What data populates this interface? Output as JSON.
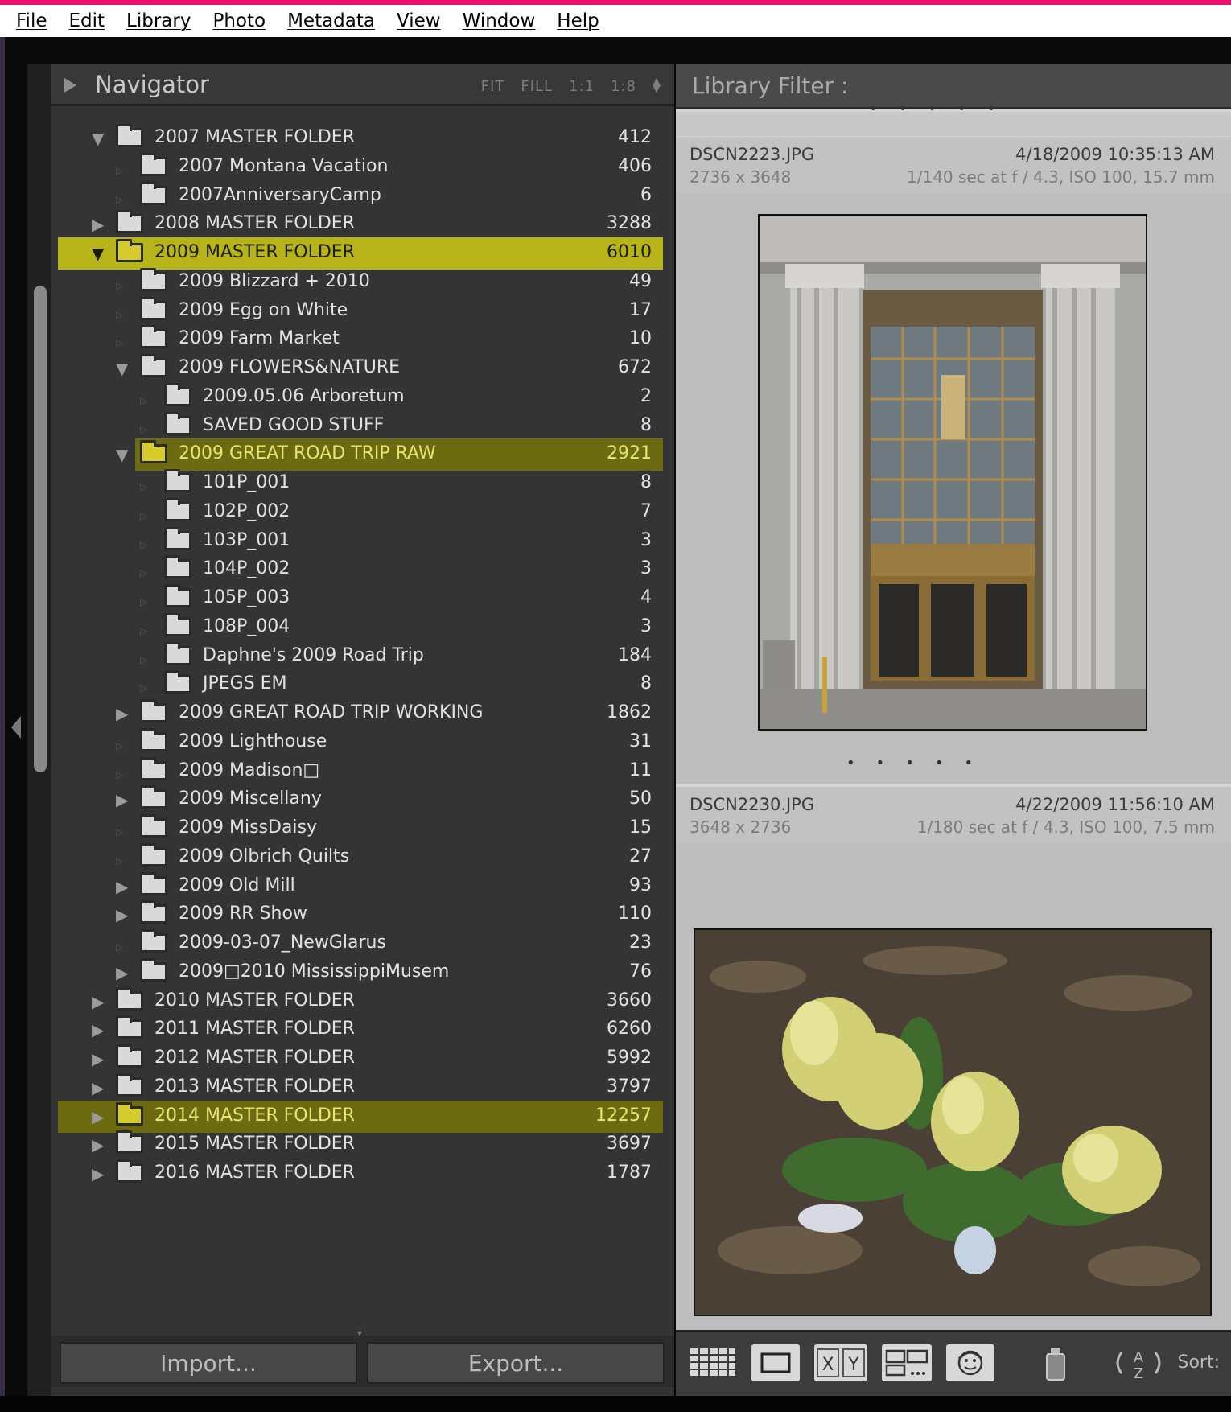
{
  "menu": [
    "File",
    "Edit",
    "Library",
    "Photo",
    "Metadata",
    "View",
    "Window",
    "Help"
  ],
  "navigator": {
    "title": "Navigator",
    "zoom_options": [
      "FIT",
      "FILL",
      "1:1",
      "1:8"
    ]
  },
  "folders": [
    {
      "name": "2007 MASTER FOLDER",
      "count": "412",
      "level": 0,
      "disclosure": "expanded",
      "highlight": "none"
    },
    {
      "name": "2007 Montana Vacation",
      "count": "406",
      "level": 1,
      "disclosure": "none",
      "highlight": "none"
    },
    {
      "name": "2007AnniversaryCamp",
      "count": "6",
      "level": 1,
      "disclosure": "none",
      "highlight": "none"
    },
    {
      "name": "2008 MASTER FOLDER",
      "count": "3288",
      "level": 0,
      "disclosure": "collapsed",
      "highlight": "none"
    },
    {
      "name": "2009 MASTER FOLDER",
      "count": "6010",
      "level": 0,
      "disclosure": "expanded",
      "highlight": "selected"
    },
    {
      "name": "2009 Blizzard + 2010",
      "count": "49",
      "level": 1,
      "disclosure": "none",
      "highlight": "none"
    },
    {
      "name": "2009 Egg on White",
      "count": "17",
      "level": 1,
      "disclosure": "none",
      "highlight": "none"
    },
    {
      "name": "2009 Farm Market",
      "count": "10",
      "level": 1,
      "disclosure": "none",
      "highlight": "none"
    },
    {
      "name": "2009 FLOWERS&NATURE",
      "count": "672",
      "level": 1,
      "disclosure": "expanded",
      "highlight": "none"
    },
    {
      "name": "2009.05.06 Arboretum",
      "count": "2",
      "level": 2,
      "disclosure": "none",
      "highlight": "none"
    },
    {
      "name": "SAVED GOOD STUFF",
      "count": "8",
      "level": 2,
      "disclosure": "none",
      "highlight": "none"
    },
    {
      "name": "2009 GREAT ROAD TRIP RAW",
      "count": "2921",
      "level": 1,
      "disclosure": "expanded",
      "highlight": "marked"
    },
    {
      "name": "101P_001",
      "count": "8",
      "level": 2,
      "disclosure": "none",
      "highlight": "none"
    },
    {
      "name": "102P_002",
      "count": "7",
      "level": 2,
      "disclosure": "none",
      "highlight": "none"
    },
    {
      "name": "103P_001",
      "count": "3",
      "level": 2,
      "disclosure": "none",
      "highlight": "none"
    },
    {
      "name": "104P_002",
      "count": "3",
      "level": 2,
      "disclosure": "none",
      "highlight": "none"
    },
    {
      "name": "105P_003",
      "count": "4",
      "level": 2,
      "disclosure": "none",
      "highlight": "none"
    },
    {
      "name": "108P_004",
      "count": "3",
      "level": 2,
      "disclosure": "none",
      "highlight": "none"
    },
    {
      "name": "Daphne's 2009 Road Trip",
      "count": "184",
      "level": 2,
      "disclosure": "none",
      "highlight": "none"
    },
    {
      "name": "JPEGS EM",
      "count": "8",
      "level": 2,
      "disclosure": "none",
      "highlight": "none"
    },
    {
      "name": "2009 GREAT ROAD TRIP WORKING",
      "count": "1862",
      "level": 1,
      "disclosure": "collapsed",
      "highlight": "none"
    },
    {
      "name": "2009 Lighthouse",
      "count": "31",
      "level": 1,
      "disclosure": "none",
      "highlight": "none"
    },
    {
      "name": "2009 Madison□",
      "count": "11",
      "level": 1,
      "disclosure": "none",
      "highlight": "none"
    },
    {
      "name": "2009 Miscellany",
      "count": "50",
      "level": 1,
      "disclosure": "collapsed",
      "highlight": "none"
    },
    {
      "name": "2009 MissDaisy",
      "count": "15",
      "level": 1,
      "disclosure": "none",
      "highlight": "none"
    },
    {
      "name": "2009 Olbrich Quilts",
      "count": "27",
      "level": 1,
      "disclosure": "none",
      "highlight": "none"
    },
    {
      "name": "2009 Old Mill",
      "count": "93",
      "level": 1,
      "disclosure": "collapsed",
      "highlight": "none"
    },
    {
      "name": "2009 RR Show",
      "count": "110",
      "level": 1,
      "disclosure": "collapsed",
      "highlight": "none"
    },
    {
      "name": "2009-03-07_NewGlarus",
      "count": "23",
      "level": 1,
      "disclosure": "none",
      "highlight": "none"
    },
    {
      "name": "2009□2010 MississippiMusem",
      "count": "76",
      "level": 1,
      "disclosure": "collapsed",
      "highlight": "none"
    },
    {
      "name": "2010 MASTER FOLDER",
      "count": "3660",
      "level": 0,
      "disclosure": "collapsed",
      "highlight": "none"
    },
    {
      "name": "2011 MASTER FOLDER",
      "count": "6260",
      "level": 0,
      "disclosure": "collapsed",
      "highlight": "none"
    },
    {
      "name": "2012 MASTER FOLDER",
      "count": "5992",
      "level": 0,
      "disclosure": "collapsed",
      "highlight": "none"
    },
    {
      "name": "2013 MASTER FOLDER",
      "count": "3797",
      "level": 0,
      "disclosure": "collapsed",
      "highlight": "none"
    },
    {
      "name": "2014 MASTER FOLDER",
      "count": "12257",
      "level": 0,
      "disclosure": "collapsed",
      "highlight": "marked"
    },
    {
      "name": "2015 MASTER FOLDER",
      "count": "3697",
      "level": 0,
      "disclosure": "collapsed",
      "highlight": "none"
    },
    {
      "name": "2016 MASTER FOLDER",
      "count": "1787",
      "level": 0,
      "disclosure": "collapsed",
      "highlight": "none"
    }
  ],
  "buttons": {
    "import": "Import...",
    "export": "Export..."
  },
  "library_filter": {
    "label": "Library Filter :"
  },
  "photos": [
    {
      "filename": "DSCN2223.JPG",
      "dimensions": "2736 x 3648",
      "date": "4/18/2009 10:35:13 AM",
      "exposure": "1/140 sec at f / 4.3, ISO 100, 15.7 mm",
      "subject": "building-entrance-photo"
    },
    {
      "filename": "DSCN2230.JPG",
      "dimensions": "3648 x 2736",
      "date": "4/22/2009 11:56:10 AM",
      "exposure": "1/180 sec at f / 4.3, ISO 100, 7.5 mm",
      "subject": "yellow-tulips-photo"
    }
  ],
  "toolbar": {
    "icons": [
      "grid-view-icon",
      "loupe-view-icon",
      "compare-view-icon",
      "survey-view-icon",
      "people-view-icon",
      "painter-icon",
      "sort-direction-icon"
    ],
    "compare_label": "X|Y",
    "sort_az": "A Z",
    "sort_label": "Sort:"
  },
  "colors": {
    "highlight": "#b6b418",
    "highlight_marked": "#6d6b12",
    "accent_pink": "#e8106a"
  }
}
